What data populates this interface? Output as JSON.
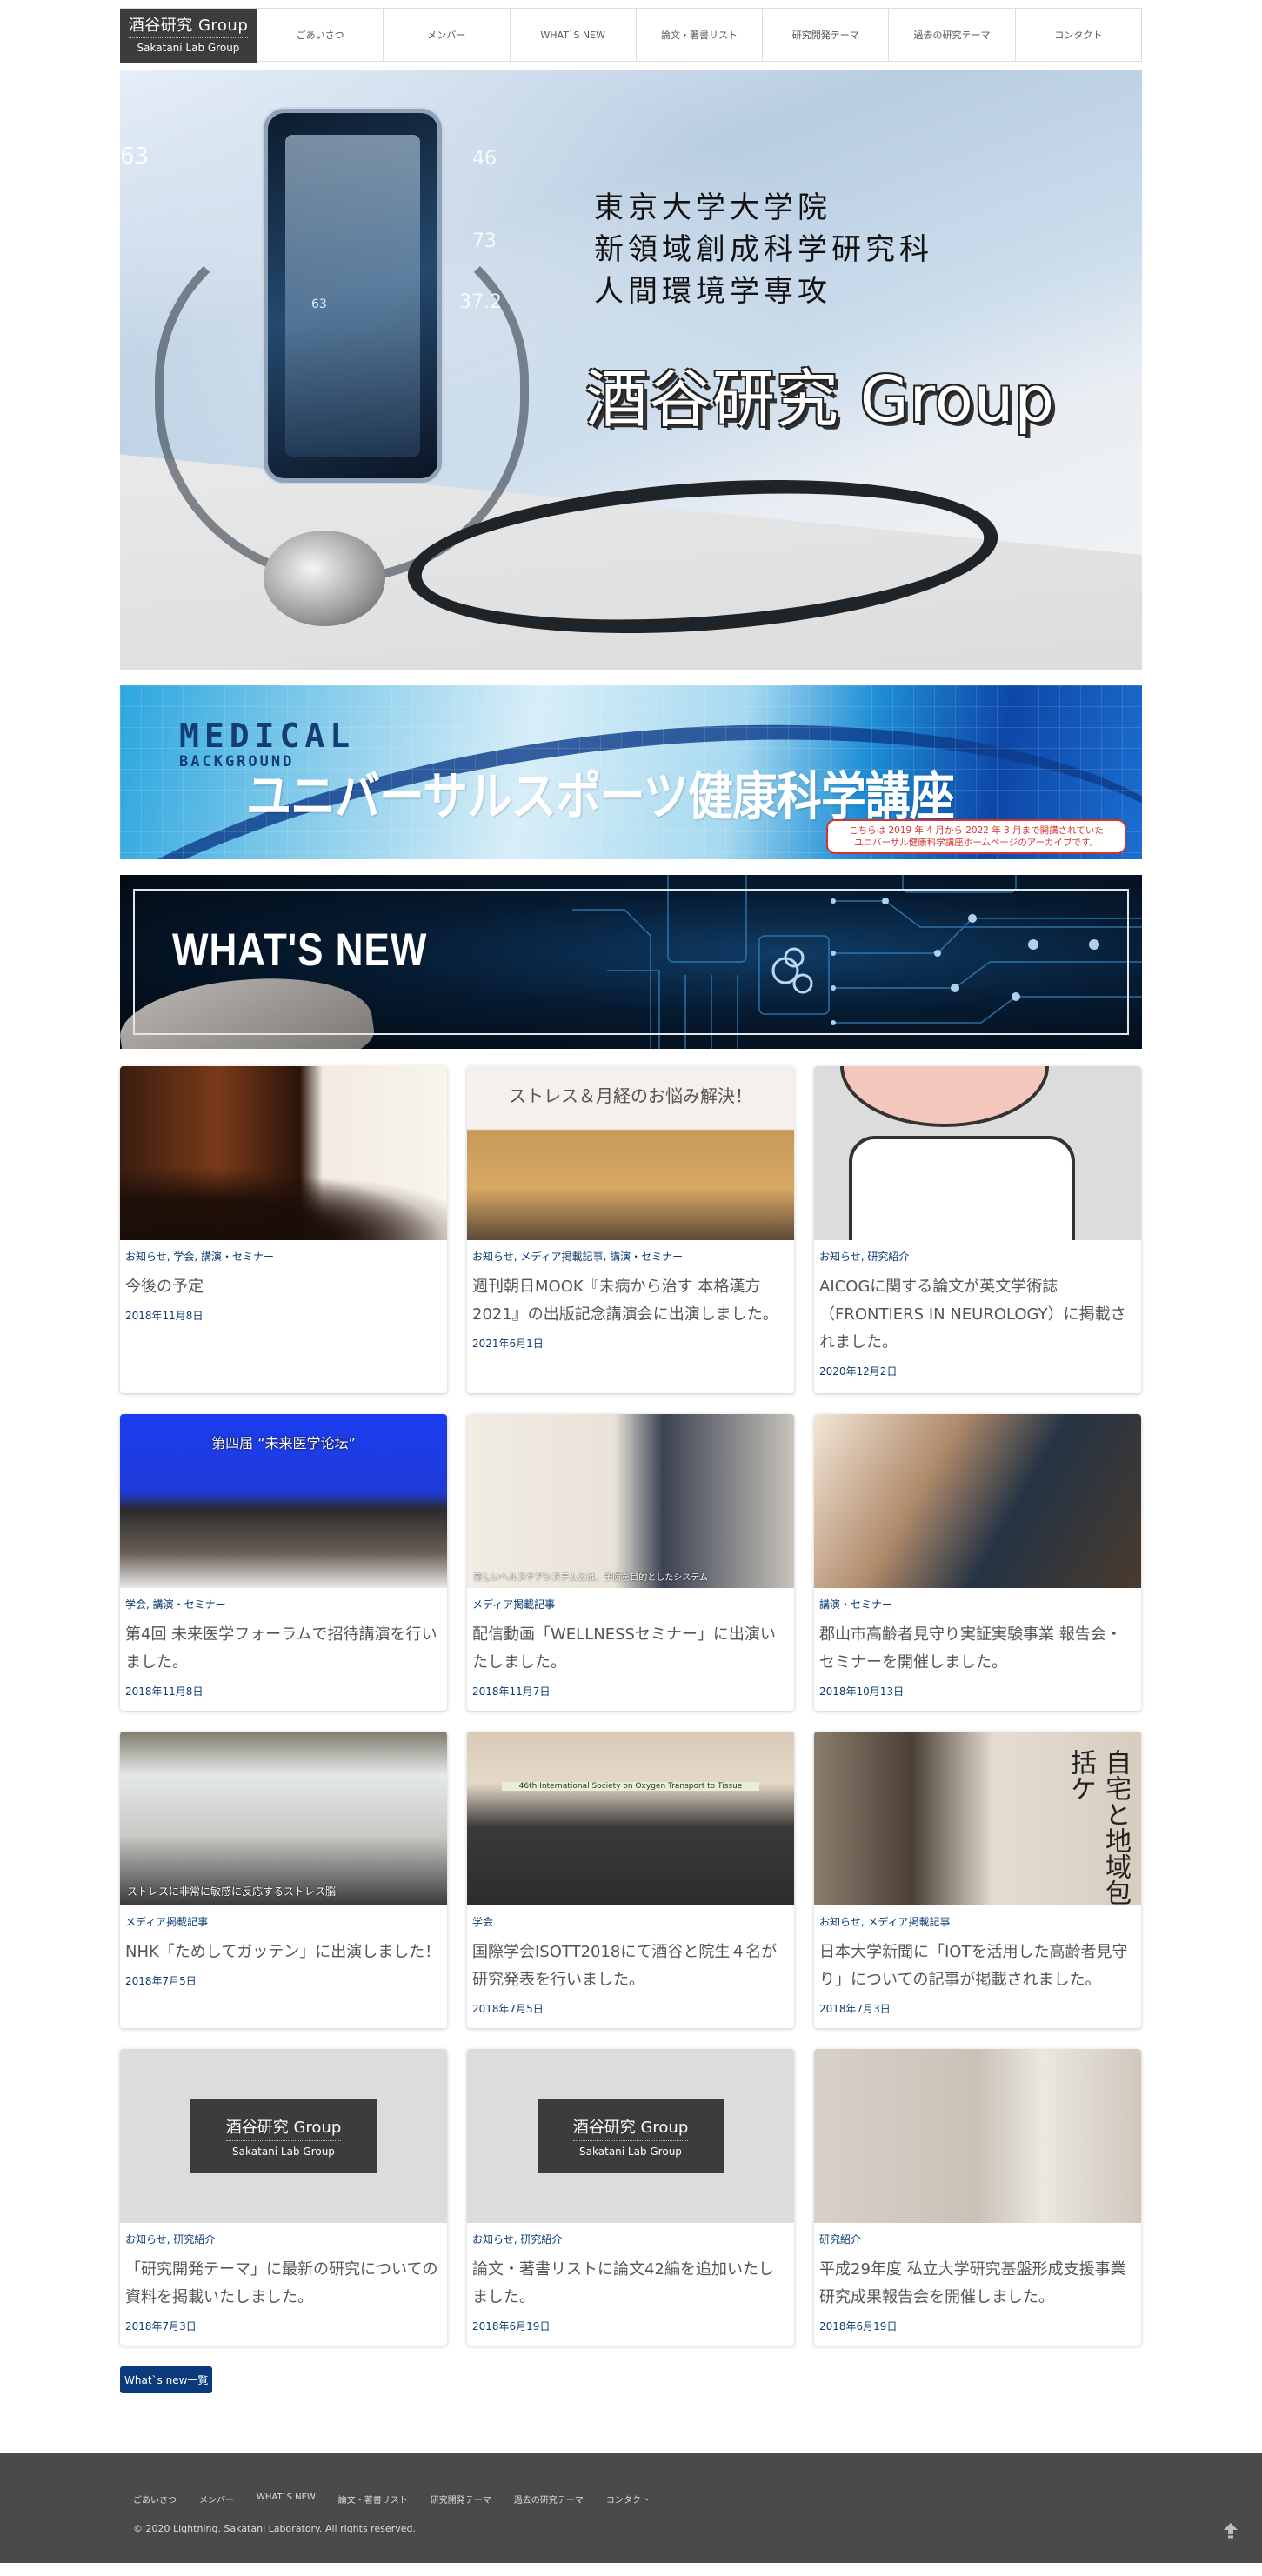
{
  "header": {
    "logo": {
      "title": "酒谷研究 Group",
      "subtitle": "Sakatani Lab Group"
    },
    "nav": [
      "ごあいさつ",
      "メンバー",
      "WHAT`S NEW",
      "論文・著書リスト",
      "研究開発テーマ",
      "過去の研究テーマ",
      "コンタクト"
    ]
  },
  "hero": {
    "lines": [
      "東京大学大学院",
      "新領域創成科学研究科",
      "人間環境学専攻"
    ],
    "title": "酒谷研究 Group",
    "hud_values": [
      "63",
      "46",
      "73",
      "37.2",
      "63"
    ]
  },
  "medical_banner": {
    "heading": "MEDICAL",
    "subheading": "BACKGROUND",
    "title": "ユニバーサルスポーツ健康科学講座",
    "note_line1": "こちらは 2019 年 4 月から 2022 年 3 月まで開講されていた",
    "note_line2": "ユニバーサル健康科学講座ホームページのアーカイブです。"
  },
  "whats_new_banner": {
    "title": "WHAT'S NEW"
  },
  "posts": [
    {
      "categories": "お知らせ, 学会, 講演・セミナー",
      "title": "今後の予定",
      "date": "2018年11月8日"
    },
    {
      "categories": "お知らせ, メディア掲載記事, 講演・セミナー",
      "title": "週刊朝日MOOK『未病から治す 本格漢方2021』の出版記念講演会に出演しました。",
      "date": "2021年6月1日",
      "image_caption": "ストレス＆月経のお悩み解決！"
    },
    {
      "categories": "お知らせ, 研究紹介",
      "title": "AICOGに関する論文が英文学術誌（FRONTIERS IN NEUROLOGY）に掲載されました。",
      "date": "2020年12月2日"
    },
    {
      "categories": "学会, 講演・セミナー",
      "title": "第4回 未来医学フォーラムで招待講演を行いました。",
      "date": "2018年11月8日",
      "image_caption": "第四届 “未来医学论坛”"
    },
    {
      "categories": "メディア掲載記事",
      "title": "配信動画「WELLNESSセミナー」に出演いたしました。",
      "date": "2018年11月7日",
      "image_caption": "新しいヘルスケアシステムとは、予防を目的としたシステム"
    },
    {
      "categories": "講演・セミナー",
      "title": "郡山市高齢者見守り実証実験事業 報告会・セミナーを開催しました。",
      "date": "2018年10月13日"
    },
    {
      "categories": "メディア掲載記事",
      "title": "NHK「ためしてガッテン」に出演しました！",
      "date": "2018年7月5日",
      "image_caption": "ストレスに非常に敏感に反応するストレス脳"
    },
    {
      "categories": "学会",
      "title": "国際学会ISOTT2018にて酒谷と院生４名が研究発表を行いました。",
      "date": "2018年7月5日",
      "image_caption": "46th International Society on Oxygen Transport to Tissue"
    },
    {
      "categories": "お知らせ, メディア掲載記事",
      "title": "日本大学新聞に「IOTを活用した高齢者見守り」についての記事が掲載されました。",
      "date": "2018年7月3日",
      "image_caption": "自宅と地域包括ケ"
    },
    {
      "categories": "お知らせ, 研究紹介",
      "title": "「研究開発テーマ」に最新の研究についての資料を掲載いたしました。",
      "date": "2018年7月3日",
      "logo_title": "酒谷研究 Group",
      "logo_subtitle": "Sakatani Lab Group"
    },
    {
      "categories": "お知らせ, 研究紹介",
      "title": "論文・著書リストに論文42編を追加いたしました。",
      "date": "2018年6月19日",
      "logo_title": "酒谷研究 Group",
      "logo_subtitle": "Sakatani Lab Group"
    },
    {
      "categories": "研究紹介",
      "title": "平成29年度 私立大学研究基盤形成支援事業 研究成果報告会を開催しました。",
      "date": "2018年6月19日"
    }
  ],
  "more_button": "What`s new一覧",
  "footer": {
    "nav": [
      "ごあいさつ",
      "メンバー",
      "WHAT`S NEW",
      "論文・著書リスト",
      "研究開発テーマ",
      "過去の研究テーマ",
      "コンタクト"
    ],
    "copyright": "© 2020 Lightning. Sakatani Laboratory. All rights reserved.",
    "back_to_top_icon": "arrow-up-icon"
  },
  "colors": {
    "accent": "#0b3a7c",
    "category_text": "#0b3a73",
    "logo_bg": "#3d3b3c",
    "footer_bg": "#4a4a4a"
  }
}
